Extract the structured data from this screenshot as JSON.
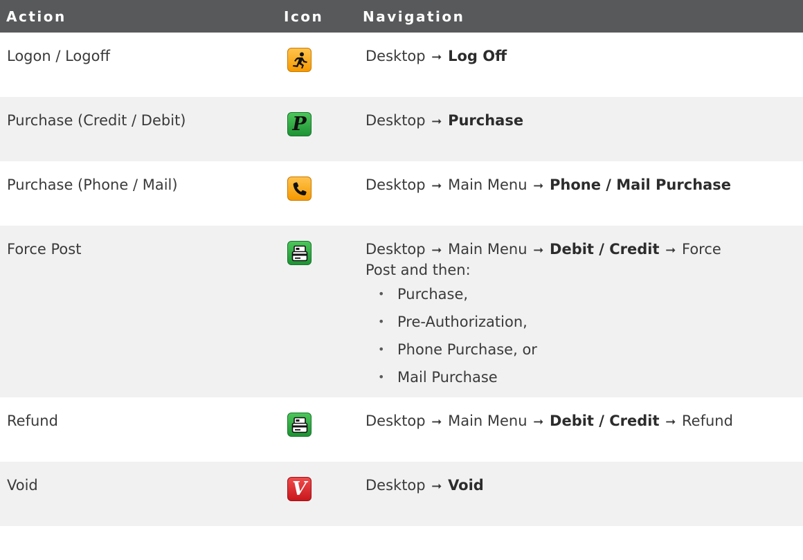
{
  "header": {
    "action": "Action",
    "icon": "Icon",
    "navigation": "Navigation"
  },
  "rows": [
    {
      "action": "Logon / Logoff",
      "icon": "runner-icon",
      "nav": {
        "desktop": "Desktop",
        "target": "Log Off"
      }
    },
    {
      "action": "Purchase (Credit / Debit)",
      "icon": "purchase-p-icon",
      "icon_letter": "P",
      "nav": {
        "desktop": "Desktop",
        "target": "Purchase"
      }
    },
    {
      "action": "Purchase (Phone / Mail)",
      "icon": "phone-icon",
      "nav": {
        "desktop": "Desktop",
        "menu": "Main Menu",
        "target": "Phone / Mail Purchase"
      }
    },
    {
      "action": "Force Post",
      "icon": "card-reader-icon",
      "nav": {
        "desktop": "Desktop",
        "menu": "Main Menu",
        "bold": "Debit / Credit",
        "tail1": "Force",
        "tail2": "Post and then:",
        "bullets": [
          "Purchase,",
          "Pre-Authorization,",
          "Phone Purchase, or",
          "Mail Purchase"
        ]
      }
    },
    {
      "action": "Refund",
      "icon": "card-reader-icon",
      "nav": {
        "desktop": "Desktop",
        "menu": "Main Menu",
        "bold": "Debit / Credit",
        "tail": "Refund"
      }
    },
    {
      "action": "Void",
      "icon": "void-v-icon",
      "icon_letter": "V",
      "nav": {
        "desktop": "Desktop",
        "target": "Void"
      }
    }
  ],
  "arrow_glyph": "➞",
  "colors": {
    "header_bg": "#58595b",
    "alt_row_bg": "#f1f1f2",
    "orange": "#f59a00",
    "green": "#1e9334",
    "red": "#c8171d"
  }
}
